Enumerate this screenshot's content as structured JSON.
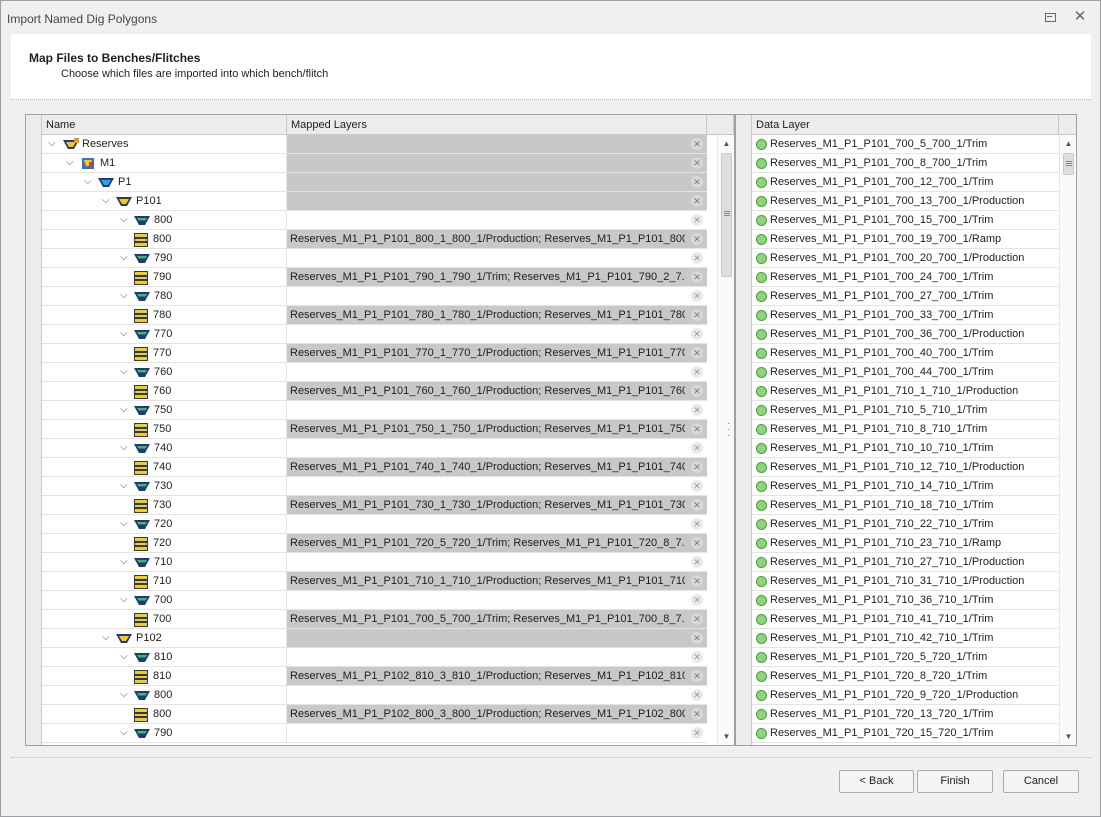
{
  "window": {
    "title": "Import Named Dig Polygons"
  },
  "header": {
    "title": "Map Files to Benches/Flitches",
    "subtitle": "Choose which files are imported into which bench/flitch"
  },
  "tree_grid": {
    "columns": {
      "name": "Name",
      "mapped": "Mapped Layers"
    },
    "rows": [
      {
        "level": 0,
        "icon": "reserves-icon",
        "label": "Reserves",
        "mapped": "",
        "shade": "gray",
        "chev": true
      },
      {
        "level": 1,
        "icon": "mine-icon",
        "label": "M1",
        "mapped": "",
        "shade": "gray",
        "chev": true
      },
      {
        "level": 2,
        "icon": "pit-icon",
        "label": "P1",
        "mapped": "",
        "shade": "gray",
        "chev": true
      },
      {
        "level": 3,
        "icon": "phase-icon",
        "label": "P101",
        "mapped": "",
        "shade": "gray",
        "chev": true
      },
      {
        "level": 4,
        "icon": "bench-group-icon",
        "label": "800",
        "mapped": "",
        "shade": "white",
        "chev": true
      },
      {
        "level": 5,
        "icon": "bench-icon",
        "label": "800",
        "mapped": "Reserves_M1_P1_P101_800_1_800_1/Production; Reserves_M1_P1_P101_800...",
        "shade": "gray",
        "chev": false
      },
      {
        "level": 4,
        "icon": "bench-group-icon",
        "label": "790",
        "mapped": "",
        "shade": "white",
        "chev": true
      },
      {
        "level": 5,
        "icon": "bench-icon",
        "label": "790",
        "mapped": "Reserves_M1_P1_P101_790_1_790_1/Trim; Reserves_M1_P1_P101_790_2_7...",
        "shade": "gray",
        "chev": false
      },
      {
        "level": 4,
        "icon": "bench-group-icon",
        "label": "780",
        "mapped": "",
        "shade": "white",
        "chev": true
      },
      {
        "level": 5,
        "icon": "bench-icon",
        "label": "780",
        "mapped": "Reserves_M1_P1_P101_780_1_780_1/Production; Reserves_M1_P1_P101_780...",
        "shade": "gray",
        "chev": false
      },
      {
        "level": 4,
        "icon": "bench-group-icon",
        "label": "770",
        "mapped": "",
        "shade": "white",
        "chev": true
      },
      {
        "level": 5,
        "icon": "bench-icon",
        "label": "770",
        "mapped": "Reserves_M1_P1_P101_770_1_770_1/Production; Reserves_M1_P1_P101_770...",
        "shade": "gray",
        "chev": false
      },
      {
        "level": 4,
        "icon": "bench-group-icon",
        "label": "760",
        "mapped": "",
        "shade": "white",
        "chev": true
      },
      {
        "level": 5,
        "icon": "bench-icon",
        "label": "760",
        "mapped": "Reserves_M1_P1_P101_760_1_760_1/Production; Reserves_M1_P1_P101_760...",
        "shade": "gray",
        "chev": false
      },
      {
        "level": 4,
        "icon": "bench-group-icon",
        "label": "750",
        "mapped": "",
        "shade": "white",
        "chev": true
      },
      {
        "level": 5,
        "icon": "bench-icon",
        "label": "750",
        "mapped": "Reserves_M1_P1_P101_750_1_750_1/Production; Reserves_M1_P1_P101_750...",
        "shade": "gray",
        "chev": false
      },
      {
        "level": 4,
        "icon": "bench-group-icon",
        "label": "740",
        "mapped": "",
        "shade": "white",
        "chev": true
      },
      {
        "level": 5,
        "icon": "bench-icon",
        "label": "740",
        "mapped": "Reserves_M1_P1_P101_740_1_740_1/Production; Reserves_M1_P1_P101_740...",
        "shade": "gray",
        "chev": false
      },
      {
        "level": 4,
        "icon": "bench-group-icon",
        "label": "730",
        "mapped": "",
        "shade": "white",
        "chev": true
      },
      {
        "level": 5,
        "icon": "bench-icon",
        "label": "730",
        "mapped": "Reserves_M1_P1_P101_730_1_730_1/Production; Reserves_M1_P1_P101_730...",
        "shade": "gray",
        "chev": false
      },
      {
        "level": 4,
        "icon": "bench-group-icon",
        "label": "720",
        "mapped": "",
        "shade": "white",
        "chev": true
      },
      {
        "level": 5,
        "icon": "bench-icon",
        "label": "720",
        "mapped": "Reserves_M1_P1_P101_720_5_720_1/Trim; Reserves_M1_P1_P101_720_8_7...",
        "shade": "gray",
        "chev": false
      },
      {
        "level": 4,
        "icon": "bench-group-icon",
        "label": "710",
        "mapped": "",
        "shade": "white",
        "chev": true
      },
      {
        "level": 5,
        "icon": "bench-icon",
        "label": "710",
        "mapped": "Reserves_M1_P1_P101_710_1_710_1/Production; Reserves_M1_P1_P101_710...",
        "shade": "gray",
        "chev": false
      },
      {
        "level": 4,
        "icon": "bench-group-icon",
        "label": "700",
        "mapped": "",
        "shade": "white",
        "chev": true
      },
      {
        "level": 5,
        "icon": "bench-icon",
        "label": "700",
        "mapped": "Reserves_M1_P1_P101_700_5_700_1/Trim; Reserves_M1_P1_P101_700_8_7...",
        "shade": "gray",
        "chev": false
      },
      {
        "level": 3,
        "icon": "phase-icon",
        "label": "P102",
        "mapped": "",
        "shade": "gray",
        "chev": true
      },
      {
        "level": 4,
        "icon": "bench-group-icon",
        "label": "810",
        "mapped": "",
        "shade": "white",
        "chev": true
      },
      {
        "level": 5,
        "icon": "bench-icon",
        "label": "810",
        "mapped": "Reserves_M1_P1_P102_810_3_810_1/Production; Reserves_M1_P1_P102_810...",
        "shade": "gray",
        "chev": false
      },
      {
        "level": 4,
        "icon": "bench-group-icon",
        "label": "800",
        "mapped": "",
        "shade": "white",
        "chev": true
      },
      {
        "level": 5,
        "icon": "bench-icon",
        "label": "800",
        "mapped": "Reserves_M1_P1_P102_800_3_800_1/Production; Reserves_M1_P1_P102_800...",
        "shade": "gray",
        "chev": false
      },
      {
        "level": 4,
        "icon": "bench-group-icon",
        "label": "790",
        "mapped": "",
        "shade": "white",
        "chev": true
      }
    ]
  },
  "data_grid": {
    "column": "Data Layer",
    "rows": [
      "Reserves_M1_P1_P101_700_5_700_1/Trim",
      "Reserves_M1_P1_P101_700_8_700_1/Trim",
      "Reserves_M1_P1_P101_700_12_700_1/Trim",
      "Reserves_M1_P1_P101_700_13_700_1/Production",
      "Reserves_M1_P1_P101_700_15_700_1/Trim",
      "Reserves_M1_P1_P101_700_19_700_1/Ramp",
      "Reserves_M1_P1_P101_700_20_700_1/Production",
      "Reserves_M1_P1_P101_700_24_700_1/Trim",
      "Reserves_M1_P1_P101_700_27_700_1/Trim",
      "Reserves_M1_P1_P101_700_33_700_1/Trim",
      "Reserves_M1_P1_P101_700_36_700_1/Production",
      "Reserves_M1_P1_P101_700_40_700_1/Trim",
      "Reserves_M1_P1_P101_700_44_700_1/Trim",
      "Reserves_M1_P1_P101_710_1_710_1/Production",
      "Reserves_M1_P1_P101_710_5_710_1/Trim",
      "Reserves_M1_P1_P101_710_8_710_1/Trim",
      "Reserves_M1_P1_P101_710_10_710_1/Trim",
      "Reserves_M1_P1_P101_710_12_710_1/Production",
      "Reserves_M1_P1_P101_710_14_710_1/Trim",
      "Reserves_M1_P1_P101_710_18_710_1/Trim",
      "Reserves_M1_P1_P101_710_22_710_1/Trim",
      "Reserves_M1_P1_P101_710_23_710_1/Ramp",
      "Reserves_M1_P1_P101_710_27_710_1/Production",
      "Reserves_M1_P1_P101_710_31_710_1/Production",
      "Reserves_M1_P1_P101_710_36_710_1/Trim",
      "Reserves_M1_P1_P101_710_41_710_1/Trim",
      "Reserves_M1_P1_P101_710_42_710_1/Trim",
      "Reserves_M1_P1_P101_720_5_720_1/Trim",
      "Reserves_M1_P1_P101_720_8_720_1/Trim",
      "Reserves_M1_P1_P101_720_9_720_1/Production",
      "Reserves_M1_P1_P101_720_13_720_1/Trim",
      "Reserves_M1_P1_P101_720_15_720_1/Trim"
    ]
  },
  "buttons": {
    "back": "< Back",
    "finish": "Finish",
    "cancel": "Cancel"
  },
  "colors": {
    "gray_cell": "#c8c8c8",
    "status_dot": "#8cd67a",
    "bench_yellow": "#ffcc00",
    "bench_blue": "#1c3a82"
  }
}
